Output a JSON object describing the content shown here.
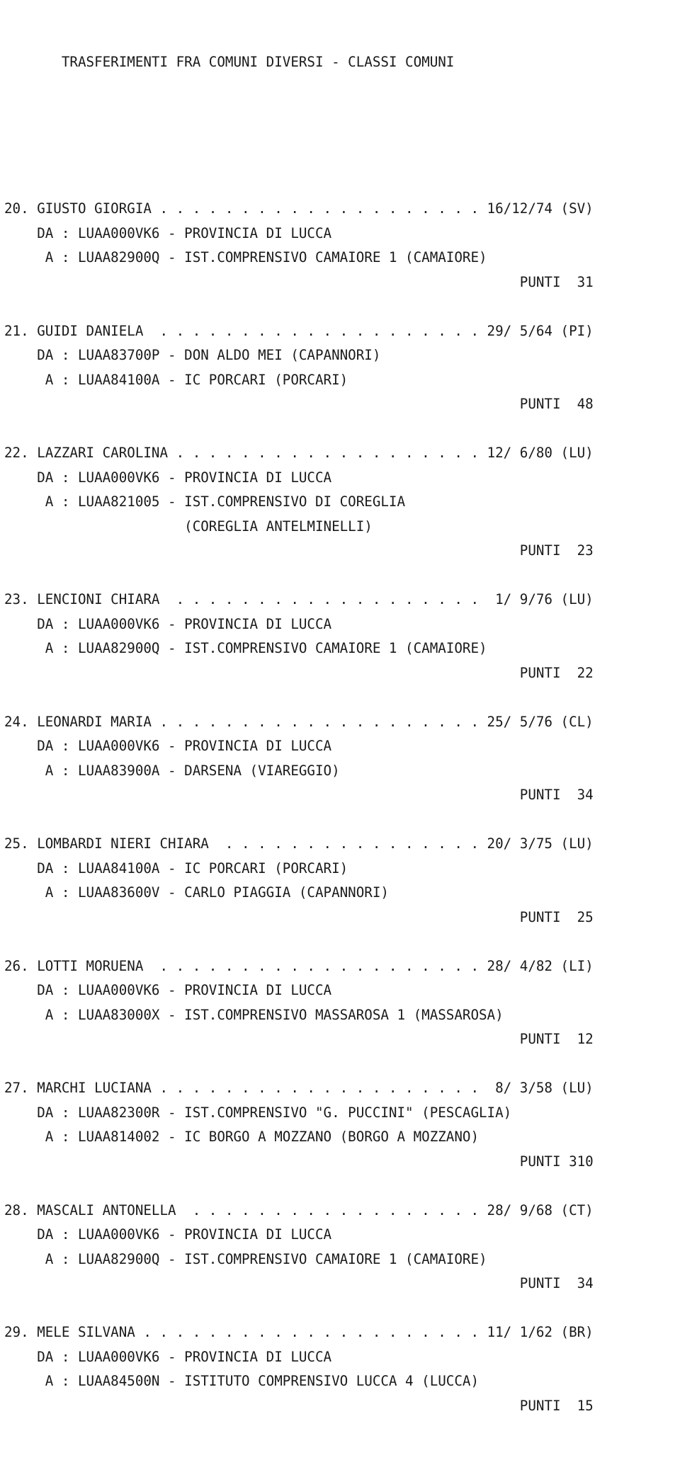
{
  "document": {
    "title": "TRASFERIMENTI FRA COMUNI DIVERSI - CLASSI COMUNI",
    "title_indent": 7,
    "line_width": 72,
    "labels": {
      "from": "DA :",
      "to": "A :",
      "points": "PUNTI"
    },
    "records": [
      {
        "num": "20.",
        "name": "GIUSTO GIORGIA",
        "date": "16/12/74",
        "province": "(SV)",
        "from_code": "LUAA000VK6",
        "from_school": "PROVINCIA DI LUCCA",
        "to_code": "LUAA82900Q",
        "to_school": "IST.COMPRENSIVO CAMAIORE 1 (CAMAIORE)",
        "to_school_extra": "",
        "points": "31"
      },
      {
        "num": "21.",
        "name": "GUIDI DANIELA",
        "date": "29/ 5/64",
        "province": "(PI)",
        "from_code": "LUAA83700P",
        "from_school": "DON ALDO MEI (CAPANNORI)",
        "to_code": "LUAA84100A",
        "to_school": "IC PORCARI (PORCARI)",
        "to_school_extra": "",
        "points": "48"
      },
      {
        "num": "22.",
        "name": "LAZZARI CAROLINA",
        "date": "12/ 6/80",
        "province": "(LU)",
        "from_code": "LUAA000VK6",
        "from_school": "PROVINCIA DI LUCCA",
        "to_code": "LUAA821005",
        "to_school": "IST.COMPRENSIVO DI COREGLIA",
        "to_school_extra": "(COREGLIA ANTELMINELLI)",
        "points": "23"
      },
      {
        "num": "23.",
        "name": "LENCIONI CHIARA",
        "date": " 1/ 9/76",
        "province": "(LU)",
        "from_code": "LUAA000VK6",
        "from_school": "PROVINCIA DI LUCCA",
        "to_code": "LUAA82900Q",
        "to_school": "IST.COMPRENSIVO CAMAIORE 1 (CAMAIORE)",
        "to_school_extra": "",
        "points": "22"
      },
      {
        "num": "24.",
        "name": "LEONARDI MARIA",
        "date": "25/ 5/76",
        "province": "(CL)",
        "from_code": "LUAA000VK6",
        "from_school": "PROVINCIA DI LUCCA",
        "to_code": "LUAA83900A",
        "to_school": "DARSENA (VIAREGGIO)",
        "to_school_extra": "",
        "points": "34"
      },
      {
        "num": "25.",
        "name": "LOMBARDI NIERI CHIARA",
        "date": "20/ 3/75",
        "province": "(LU)",
        "from_code": "LUAA84100A",
        "from_school": "IC PORCARI (PORCARI)",
        "to_code": "LUAA83600V",
        "to_school": "CARLO PIAGGIA (CAPANNORI)",
        "to_school_extra": "",
        "points": "25"
      },
      {
        "num": "26.",
        "name": "LOTTI MORUENA",
        "date": "28/ 4/82",
        "province": "(LI)",
        "from_code": "LUAA000VK6",
        "from_school": "PROVINCIA DI LUCCA",
        "to_code": "LUAA83000X",
        "to_school": "IST.COMPRENSIVO MASSAROSA 1 (MASSAROSA)",
        "to_school_extra": "",
        "points": "12"
      },
      {
        "num": "27.",
        "name": "MARCHI LUCIANA",
        "date": " 8/ 3/58",
        "province": "(LU)",
        "from_code": "LUAA82300R",
        "from_school": "IST.COMPRENSIVO \"G. PUCCINI\" (PESCAGLIA)",
        "to_code": "LUAA814002",
        "to_school": "IC BORGO A MOZZANO (BORGO A MOZZANO)",
        "to_school_extra": "",
        "points": "310"
      },
      {
        "num": "28.",
        "name": "MASCALI ANTONELLA",
        "date": "28/ 9/68",
        "province": "(CT)",
        "from_code": "LUAA000VK6",
        "from_school": "PROVINCIA DI LUCCA",
        "to_code": "LUAA82900Q",
        "to_school": "IST.COMPRENSIVO CAMAIORE 1 (CAMAIORE)",
        "to_school_extra": "",
        "points": "34"
      },
      {
        "num": "29.",
        "name": "MELE SILVANA",
        "date": "11/ 1/62",
        "province": "(BR)",
        "from_code": "LUAA000VK6",
        "from_school": "PROVINCIA DI LUCCA",
        "to_code": "LUAA84500N",
        "to_school": "ISTITUTO COMPRENSIVO LUCCA 4 (LUCCA)",
        "to_school_extra": "",
        "points": "15"
      }
    ]
  }
}
